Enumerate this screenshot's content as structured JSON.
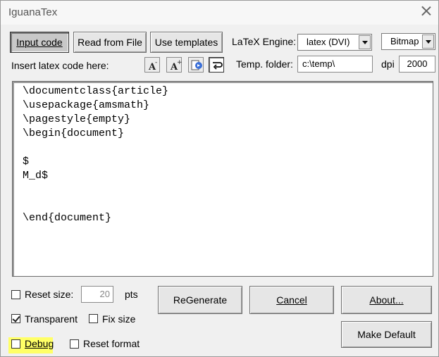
{
  "window": {
    "title": "IguanaTex"
  },
  "buttons": {
    "input_code": "Input code",
    "read_from_file": "Read from File",
    "use_templates": "Use templates",
    "regenerate": "ReGenerate",
    "cancel": "Cancel",
    "about": "About...",
    "make_default": "Make Default"
  },
  "labels": {
    "latex_engine": "LaTeX Engine:",
    "insert_code": "Insert latex code here:",
    "temp_folder": "Temp. folder:",
    "dpi": "dpi",
    "reset_size": "Reset size:",
    "pts": "pts",
    "transparent": "Transparent",
    "fix_size": "Fix size",
    "debug": "Debug",
    "reset_format": "Reset format"
  },
  "fields": {
    "engine": "latex (DVI)",
    "output_format": "Bitmap",
    "temp_folder": "c:\\temp\\",
    "dpi": "2000",
    "reset_size": "20"
  },
  "checkboxes": {
    "reset_size": false,
    "transparent": true,
    "fix_size": false,
    "debug": false,
    "reset_format": false
  },
  "editor": {
    "code": "\\documentclass{article}\n\\usepackage{amsmath}\n\\pagestyle{empty}\n\\begin{document}\n\n$\nM_d$\n\n\n\\end{document}"
  },
  "toolbar": {
    "icons": [
      "font-decrease-icon",
      "font-increase-icon",
      "insert-template-icon",
      "word-wrap-icon"
    ]
  },
  "colors": {
    "highlight": "#ffff66"
  }
}
